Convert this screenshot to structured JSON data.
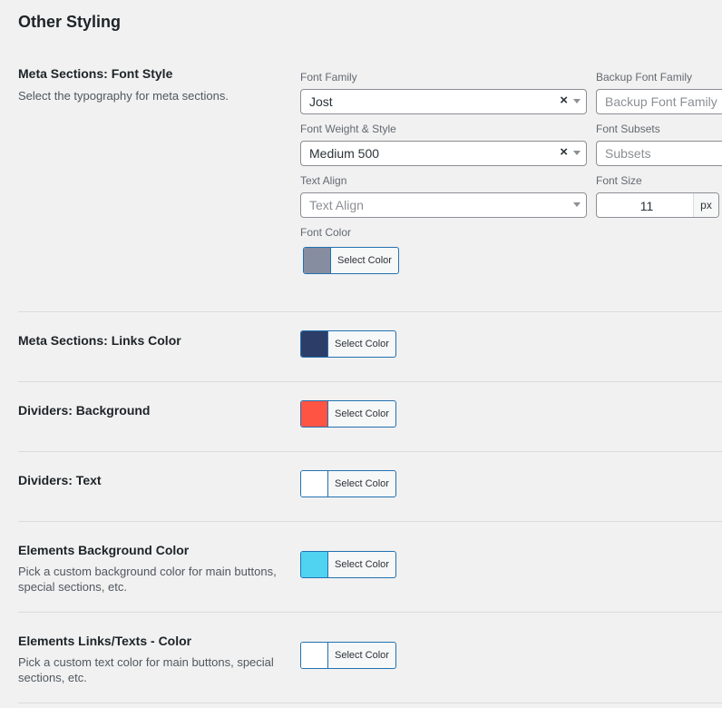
{
  "page_title": "Other Styling",
  "meta_font": {
    "title": "Meta Sections: Font Style",
    "desc": "Select the typography for meta sections.",
    "font_family_label": "Font Family",
    "font_family_value": "Jost",
    "backup_font_label": "Backup Font Family",
    "backup_font_placeholder": "Backup Font Family",
    "weight_label": "Font Weight & Style",
    "weight_value": "Medium 500",
    "subsets_label": "Font Subsets",
    "subsets_placeholder": "Subsets",
    "align_label": "Text Align",
    "align_placeholder": "Text Align",
    "size_label": "Font Size",
    "size_value": "11",
    "size_unit": "px",
    "color_label": "Font Color",
    "color": "#878da1"
  },
  "select_color_label": "Select Color",
  "clear_glyph": "×",
  "rows": [
    {
      "title": "Meta Sections: Links Color",
      "desc": "",
      "color": "#2c3e67"
    },
    {
      "title": "Dividers: Background",
      "desc": "",
      "color": "#fe5444"
    },
    {
      "title": "Dividers: Text",
      "desc": "",
      "color": "#ffffff"
    },
    {
      "title": "Elements Background Color",
      "desc": "Pick a custom background color for main buttons, special sections, etc.",
      "color": "#4fd3f1"
    },
    {
      "title": "Elements Links/Texts - Color",
      "desc": "Pick a custom text color for main buttons, special sections, etc.",
      "color": "#ffffff"
    }
  ]
}
